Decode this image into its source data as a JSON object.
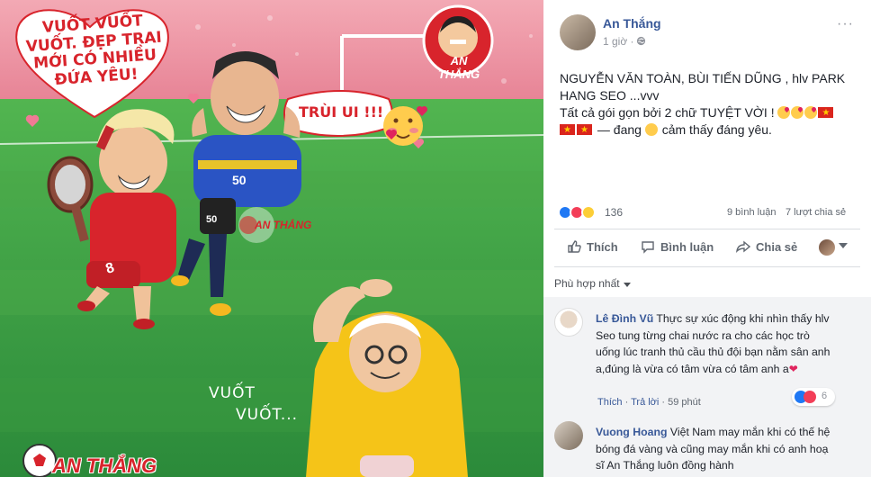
{
  "photo": {
    "heart_text": "VUỐT VUỐT VUỐT. ĐẸP TRAI MỚI CÓ NHIỀU ĐỨA YÊU!",
    "trui_text": "TRÙI UI !!!",
    "vuot_line1": "VUỐT",
    "vuot_line2": "VUỐT...",
    "badge_text": "AN THẮNG",
    "watermark_text": "AN THẮNG",
    "logo_text": "AN THẮNG",
    "jersey_number_blue": "50",
    "jersey_number_shorts": "50",
    "jersey_number_red": "8"
  },
  "post": {
    "author": "An Thắng",
    "time": "1 giờ",
    "line1": "NGUYỄN VĂN TOÀN, BÙI TIẾN DŨNG , hlv PARK",
    "line2": "HANG SEO ...vvv",
    "line3": "Tất cả gói gọn bởi 2 chữ TUYỆT VỜI !",
    "feeling_prefix": "— đang",
    "feeling_text": "cảm thấy đáng yêu.",
    "reactions_count": "136",
    "comments_count": "9 bình luận",
    "shares_count": "7 lượt chia sẻ"
  },
  "actions": {
    "like": "Thích",
    "comment": "Bình luận",
    "share": "Chia sẻ"
  },
  "sort_label": "Phù hợp nhất",
  "comments": [
    {
      "name": "Lê Đình Vũ",
      "text": "Thực sự xúc động khi nhìn thấy hlv Seo tung từng chai nước ra cho các học trò uống lúc tranh thủ cầu thủ đội bạn nằm sân anh a,đúng là vừa có tâm vừa có tâm anh a",
      "like_label": "Thích",
      "reply_label": "Trả lời",
      "time": "59 phút",
      "reaction_count": "6"
    },
    {
      "name": "Vuong Hoang",
      "text": "Việt Nam may mắn khi có thế hệ bóng đá vàng và cũng may mắn khi có anh hoạ sĩ An Thắng luôn đồng hành"
    }
  ],
  "colors": {
    "link": "#385898",
    "text": "#1d2129",
    "muted": "#606770",
    "pitch": "#2a8a3c"
  }
}
